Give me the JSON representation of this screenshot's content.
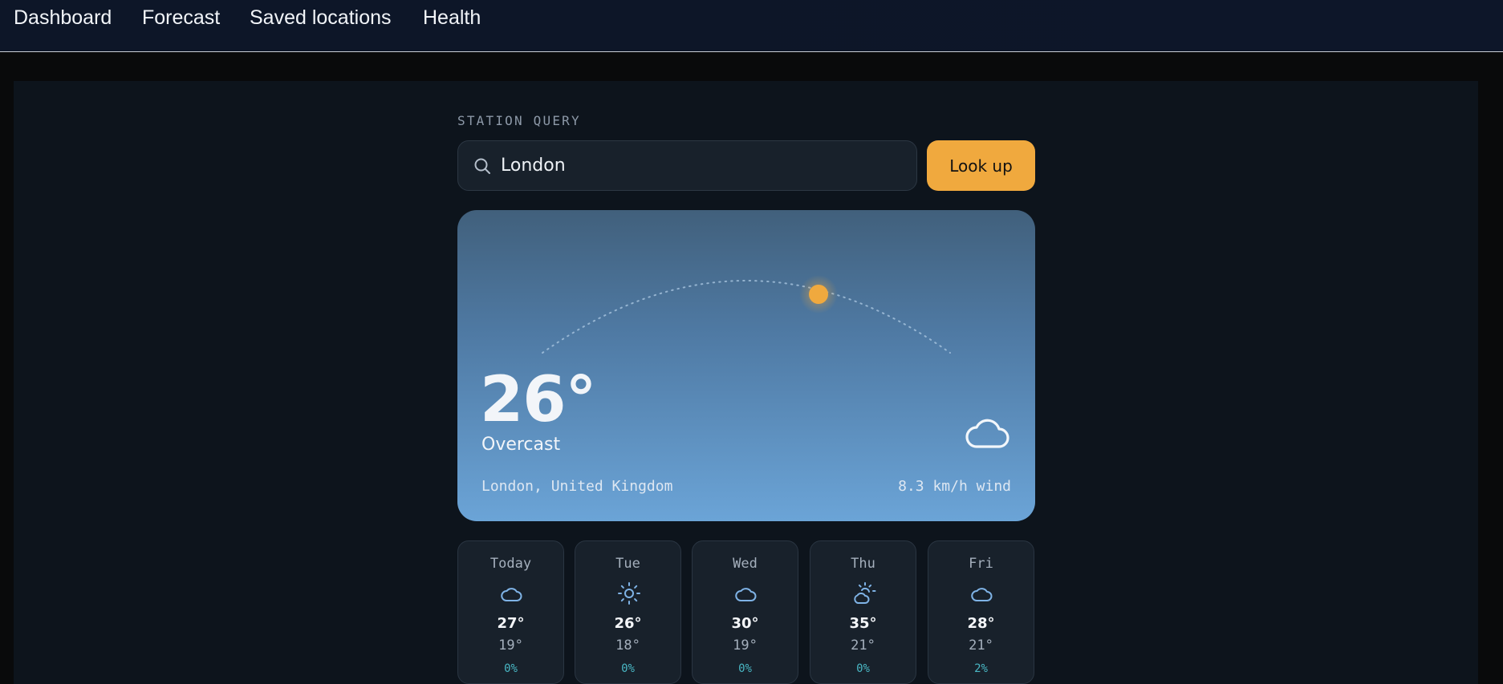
{
  "nav": {
    "items": [
      {
        "label": "Dashboard"
      },
      {
        "label": "Forecast"
      },
      {
        "label": "Saved locations"
      },
      {
        "label": "Health"
      }
    ]
  },
  "search": {
    "section_label": "STATION QUERY",
    "value": "London",
    "icon": "search-icon",
    "button_label": "Look up"
  },
  "current": {
    "temperature": "26°",
    "condition": "Overcast",
    "condition_icon": "cloud-icon",
    "location": "London, United Kingdom",
    "wind": "8.3 km/h wind"
  },
  "forecast": [
    {
      "day": "Today",
      "icon": "cloud-icon",
      "high": "27°",
      "low": "19°",
      "precip": "0%"
    },
    {
      "day": "Tue",
      "icon": "sun-icon",
      "high": "26°",
      "low": "18°",
      "precip": "0%"
    },
    {
      "day": "Wed",
      "icon": "cloud-icon",
      "high": "30°",
      "low": "19°",
      "precip": "0%"
    },
    {
      "day": "Thu",
      "icon": "partly-cloudy-icon",
      "high": "35°",
      "low": "21°",
      "precip": "0%"
    },
    {
      "day": "Fri",
      "icon": "cloud-icon",
      "high": "28°",
      "low": "21°",
      "precip": "2%"
    }
  ],
  "colors": {
    "accent": "#f0a93e",
    "precip": "#49b7c4",
    "icon": "#7fb3e6"
  }
}
